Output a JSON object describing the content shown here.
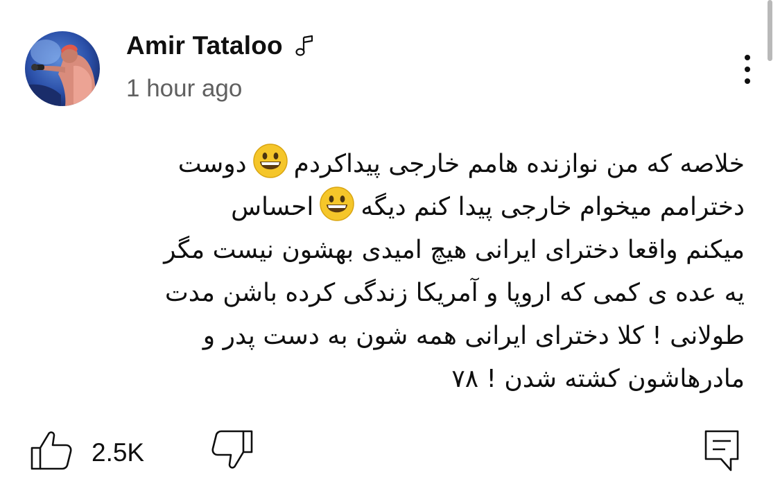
{
  "post": {
    "author": "Amir Tataloo",
    "timestamp": "1 hour ago",
    "author_badge_icon": "music-note-icon",
    "more_icon": "more-vertical-icon"
  },
  "comment": {
    "lines": [
      "خلاصه که من نوازنده هامم خارجی پیداکردم",
      "دوست",
      "دخترامم میخوام خارجی پیدا کنم دیگه",
      "احساس",
      "میکنم واقعا دخترای ایرانی هیچ امیدی بهشون نیست مگر",
      "یه عده ی کمی که اروپا و آمریکا زندگی کرده باشن مدت",
      "طولانی ! کلا دخترای ایرانی همه شون به دست پدر و",
      "مادرهاشون کشته شدن ! ۷۸"
    ],
    "emojis": [
      "grinning-face-emoji",
      "grinning-face-emoji"
    ]
  },
  "actions": {
    "like_count": "2.5K",
    "like_icon": "thumbs-up-icon",
    "dislike_icon": "thumbs-down-icon",
    "reply_icon": "comment-reply-icon"
  },
  "colors": {
    "text": "#0f0f0f",
    "secondary_text": "#606060",
    "emoji_face": "#f5c62a",
    "scrollbar": "#b9b9b9"
  }
}
